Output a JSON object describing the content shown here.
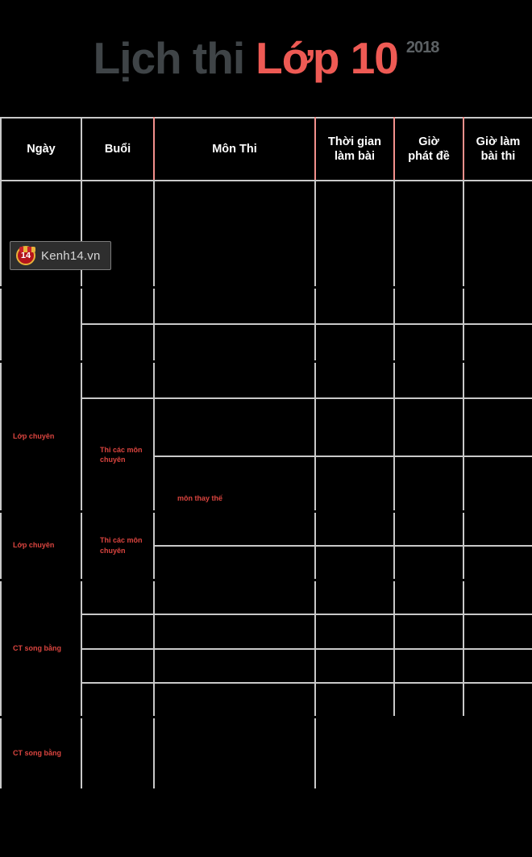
{
  "title": {
    "part_dark": "Lịch thi",
    "part_red": "Lớp 10",
    "year": "2018"
  },
  "watermark": {
    "badge_number": "14",
    "label": "Kenh14.vn"
  },
  "colors": {
    "header_background": "#ec5450",
    "title_dark": "#3f4447",
    "title_red": "#ee5a54",
    "grid_line": "#c9c9c9",
    "cell_background": "#000000",
    "annotation_red": "#ee4b45"
  },
  "table": {
    "columns": [
      {
        "key": "ngay",
        "label": "Ngày"
      },
      {
        "key": "buoi",
        "label": "Buổi"
      },
      {
        "key": "mon_thi",
        "label": "Môn Thi"
      },
      {
        "key": "thoi_gian",
        "label": "Thời gian\nlàm bài"
      },
      {
        "key": "gio_phat_de",
        "label": "Giờ\nphát đề"
      },
      {
        "key": "gio_lam_bai",
        "label": "Giờ làm\nbài thi"
      }
    ],
    "column_labels": {
      "ngay": "Ngày",
      "buoi": "Buổi",
      "mon_thi": "Môn Thi",
      "thoi_gian_line1": "Thời gian",
      "thoi_gian_line2": "làm bài",
      "gio_phat_de_line1": "Giờ",
      "gio_phat_de_line2": "phát đề",
      "gio_lam_bai_line1": "Giờ làm",
      "gio_lam_bai_line2": "bài thi"
    },
    "groups": [
      {
        "id": "group-1",
        "rows": [
          {
            "ngay": "",
            "buoi": "",
            "mon_thi": "",
            "thoi_gian": "",
            "gio_phat_de": "",
            "gio_lam_bai": ""
          }
        ]
      },
      {
        "id": "group-2",
        "rows": [
          {
            "ngay": "",
            "buoi": "",
            "mon_thi": "",
            "thoi_gian": "",
            "gio_phat_de": "",
            "gio_lam_bai": ""
          },
          {
            "buoi": "",
            "mon_thi": "",
            "thoi_gian": "",
            "gio_phat_de": "",
            "gio_lam_bai": ""
          }
        ]
      },
      {
        "id": "group-3",
        "ngay": "Lớp chuyên",
        "buoi_merged": "Thi các môn\nchuyên",
        "buoi_merged_line1": "Thi các môn",
        "buoi_merged_line2": "chuyên",
        "rows": [
          {
            "buoi": "",
            "mon_thi": "",
            "thoi_gian": "",
            "gio_phat_de": "",
            "gio_lam_bai": ""
          },
          {
            "mon_thi": "",
            "thoi_gian": "",
            "gio_phat_de": "",
            "gio_lam_bai": ""
          },
          {
            "mon_thi": "môn thay thế",
            "thoi_gian": "",
            "gio_phat_de": "",
            "gio_lam_bai": ""
          }
        ]
      },
      {
        "id": "group-4",
        "ngay": "Lớp chuyên",
        "buoi_merged_line1": "Thi các môn",
        "buoi_merged_line2": "chuyên",
        "rows": [
          {
            "mon_thi": "",
            "thoi_gian": "",
            "gio_phat_de": "",
            "gio_lam_bai": ""
          },
          {
            "mon_thi": "",
            "thoi_gian": "",
            "gio_phat_de": "",
            "gio_lam_bai": ""
          }
        ]
      },
      {
        "id": "group-5",
        "ngay": "CT song bằng",
        "rows": [
          {
            "buoi": "",
            "mon_thi": "",
            "thoi_gian": "",
            "gio_phat_de": "",
            "gio_lam_bai": ""
          },
          {
            "buoi": "",
            "mon_thi": "",
            "thoi_gian": "",
            "gio_phat_de": "",
            "gio_lam_bai": ""
          },
          {
            "buoi": "",
            "mon_thi": "",
            "thoi_gian": "",
            "gio_phat_de": "",
            "gio_lam_bai": ""
          },
          {
            "buoi": "",
            "mon_thi": "",
            "thoi_gian": "",
            "gio_phat_de": "",
            "gio_lam_bai": ""
          }
        ]
      },
      {
        "id": "group-6",
        "ngay": "CT song bằng",
        "rows": [
          {
            "buoi": "",
            "mon_thi": "",
            "merged_tail": ""
          }
        ]
      }
    ]
  }
}
